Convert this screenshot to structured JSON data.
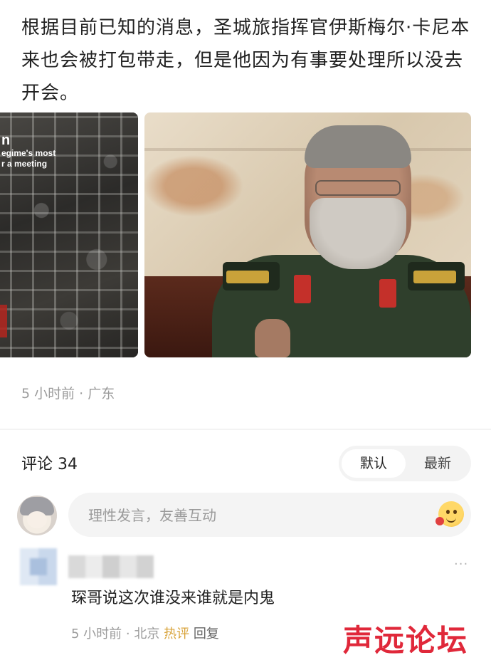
{
  "post": {
    "text": "根据目前已知的消息，圣城旅指挥官伊斯梅尔·卡尼本来也会被打包带走，但是他因为有事要处理所以没去开会。",
    "image_left_caption_big": "n",
    "image_left_caption_line1": "egime's most",
    "image_left_caption_line2": "r a meeting",
    "meta": "5 小时前 · 广东"
  },
  "comments": {
    "title": "评论 34",
    "sort_default": "默认",
    "sort_latest": "最新",
    "input_placeholder": "理性发言，友善互动",
    "items": [
      {
        "text": "琛哥说这次谁没来谁就是内鬼",
        "time_location": "5 小时前 · 北京",
        "hot_label": "热评",
        "reply_label": "回复",
        "more": "···"
      }
    ]
  },
  "watermark": "声远论坛"
}
